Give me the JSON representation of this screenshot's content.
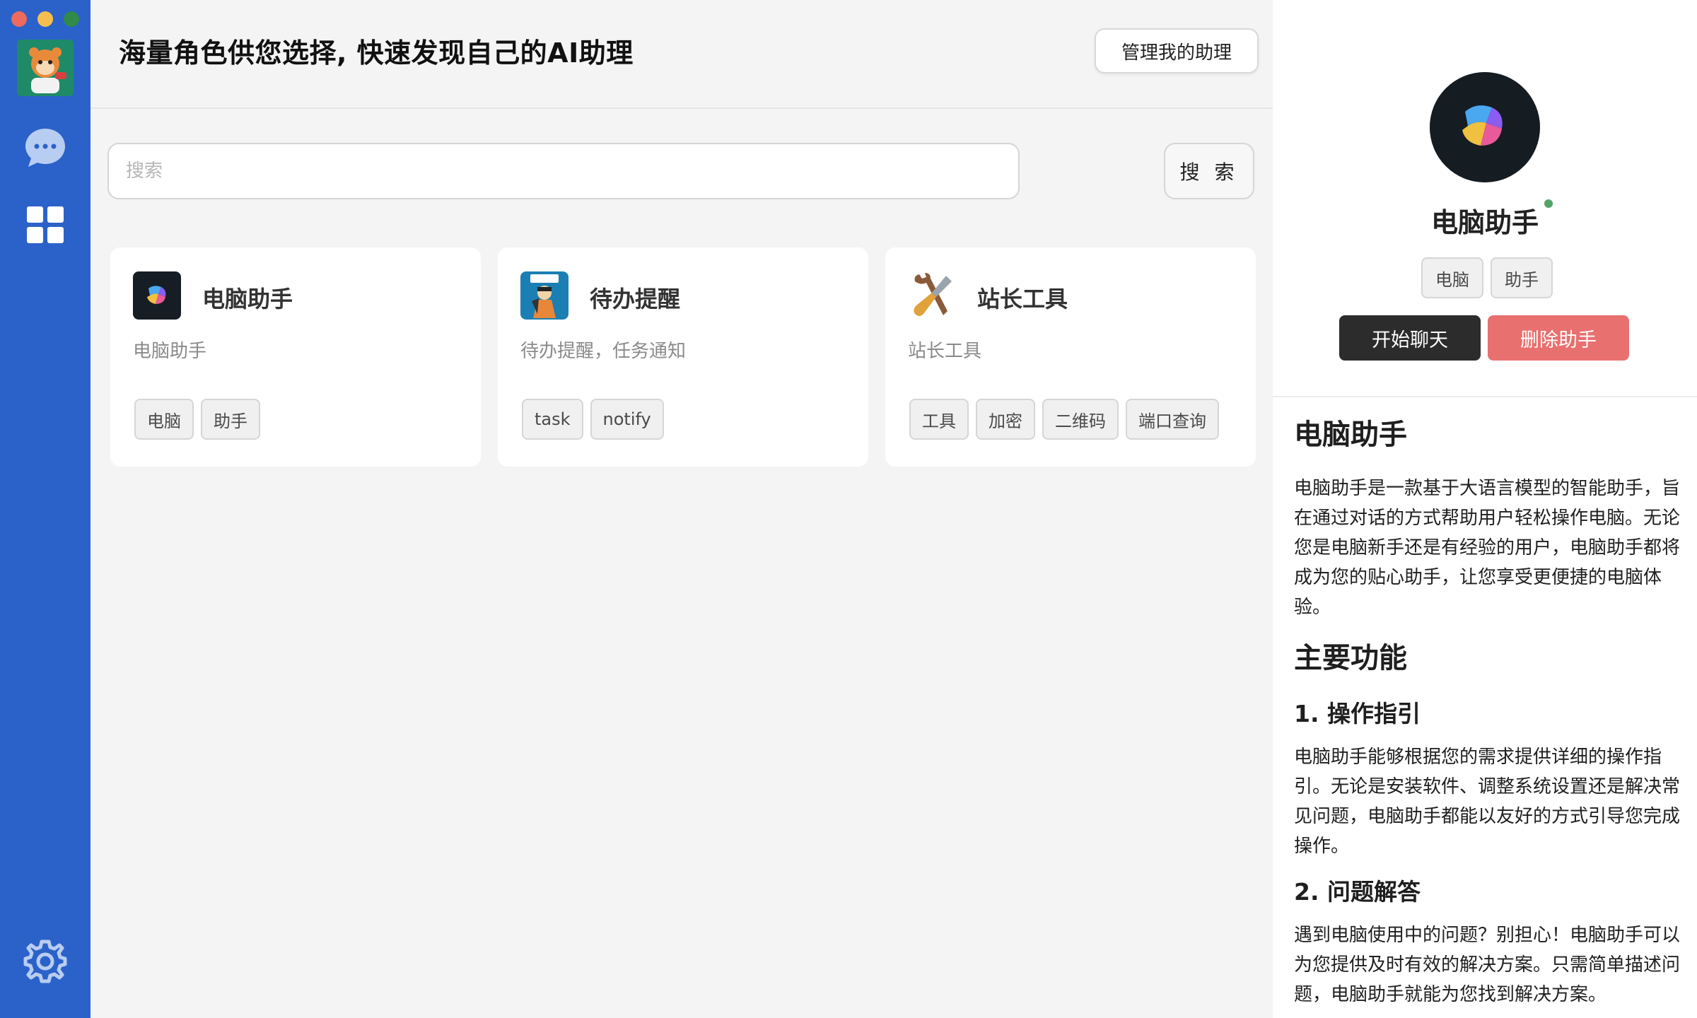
{
  "sidebar": {
    "icons": {
      "avatar": "cartoon-avatar",
      "chat": "chat-bubble-icon",
      "grid": "grid-icon",
      "settings": "gear-icon"
    },
    "accent": "#2b62c9"
  },
  "header": {
    "title": "海量角色供您选择, 快速发现自己的AI助理",
    "manage_label": "管理我的助理"
  },
  "search": {
    "placeholder": "搜索",
    "value": "",
    "button_label": "搜 索"
  },
  "cards": [
    {
      "title": "电脑助手",
      "desc": "电脑助手",
      "tags": [
        "电脑",
        "助手"
      ],
      "icon": "copilot-icon"
    },
    {
      "title": "待办提醒",
      "desc": "待办提醒，任务通知",
      "tags": [
        "task",
        "notify"
      ],
      "icon": "todo-icon"
    },
    {
      "title": "站长工具",
      "desc": "站长工具",
      "tags": [
        "工具",
        "加密",
        "二维码",
        "端口查询"
      ],
      "icon": "tools-icon"
    }
  ],
  "detail": {
    "name": "电脑助手",
    "tags": [
      "电脑",
      "助手"
    ],
    "chat_label": "开始聊天",
    "delete_label": "删除助手",
    "doc": {
      "h1": "电脑助手",
      "intro": "电脑助手是一款基于大语言模型的智能助手，旨在通过对话的方式帮助用户轻松操作电脑。无论您是电脑新手还是有经验的用户，电脑助手都将成为您的贴心助手，让您享受更便捷的电脑体验。",
      "features_title": "主要功能",
      "f1_title": "1. 操作指引",
      "f1_text": "电脑助手能够根据您的需求提供详细的操作指引。无论是安装软件、调整系统设置还是解决常见问题，电脑助手都能以友好的方式引导您完成操作。",
      "f2_title": "2. 问题解答",
      "f2_text": "遇到电脑使用中的问题？别担心！电脑助手可以为您提供及时有效的解决方案。只需简单描述问题，电脑助手就能为您找到解决方案。"
    }
  },
  "colors": {
    "danger": "#e8706f",
    "dark_button": "#2c2c2c",
    "online": "#52a36a"
  }
}
